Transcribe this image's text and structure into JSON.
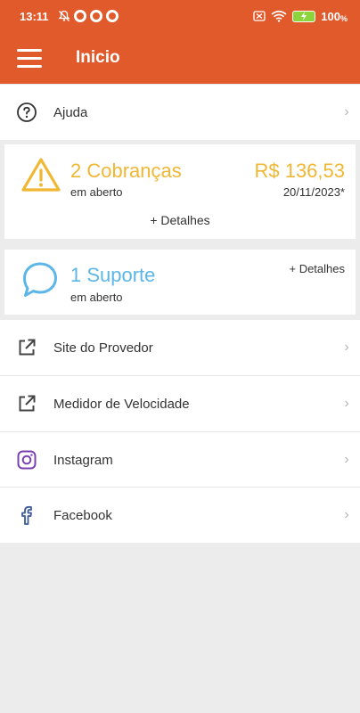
{
  "status": {
    "time": "13:11",
    "battery": "100"
  },
  "header": {
    "title": "Inicio"
  },
  "help": {
    "label": "Ajuda"
  },
  "billing": {
    "title": "2 Cobranças",
    "subtitle": "em aberto",
    "amount": "R$ 136,53",
    "date": "20/11/2023*",
    "details": "+ Detalhes",
    "color": "#f0b733"
  },
  "support": {
    "title": "1 Suporte",
    "subtitle": "em aberto",
    "details": "+ Detalhes",
    "color": "#5cb6e8"
  },
  "links": [
    {
      "label": "Site do Provedor",
      "icon": "external-link-icon"
    },
    {
      "label": "Medidor de Velocidade",
      "icon": "external-link-icon"
    },
    {
      "label": "Instagram",
      "icon": "instagram-icon",
      "color": "#7b3fb5"
    },
    {
      "label": "Facebook",
      "icon": "facebook-icon",
      "color": "#3b5998"
    }
  ],
  "colors": {
    "brand": "#e05a2b",
    "background": "#ececec"
  }
}
